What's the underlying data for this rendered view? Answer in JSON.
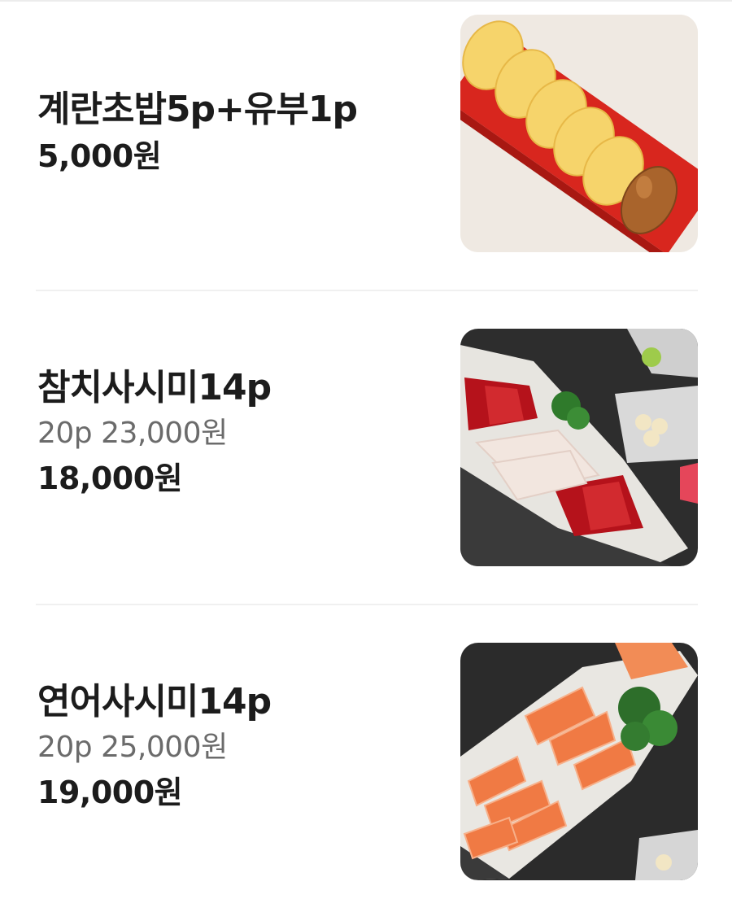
{
  "menu": {
    "items": [
      {
        "name": "계란초밥5p+유부1p",
        "price": "5,000원",
        "image_icon": "egg-sushi-photo"
      },
      {
        "name": "참치사시미14p",
        "original": "20p 23,000원",
        "price": "18,000원",
        "image_icon": "tuna-sashimi-photo"
      },
      {
        "name": "연어사시미14p",
        "original": "20p 25,000원",
        "price": "19,000원",
        "image_icon": "salmon-sashimi-photo"
      }
    ]
  }
}
